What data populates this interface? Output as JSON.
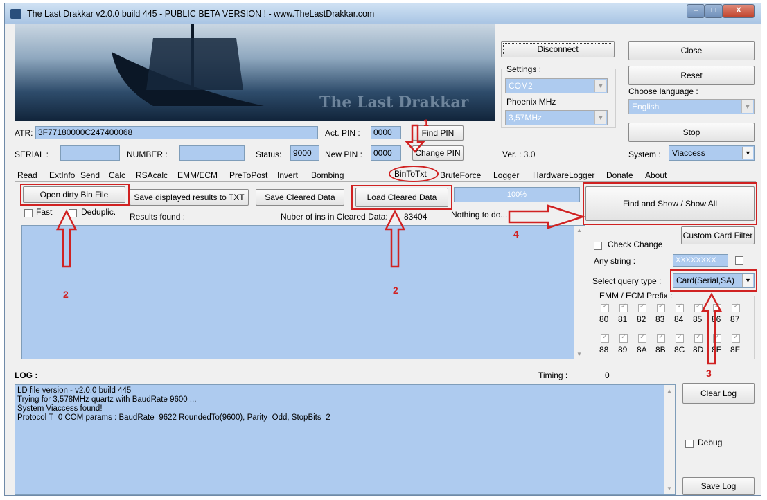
{
  "window": {
    "title": "The Last Drakkar v2.0.0 build 445  -  PUBLIC BETA VERSION ! - www.TheLastDrakkar.com",
    "banner_text": "The Last Drakkar",
    "minimize": "–",
    "maximize": "□",
    "close": "X"
  },
  "right_panel": {
    "disconnect": "Disconnect",
    "close": "Close",
    "reset": "Reset",
    "settings_label": "Settings :",
    "com_port": "COM2",
    "phoenix_label": "Phoenix MHz",
    "mhz_value": "3,57MHz",
    "choose_language_label": "Choose language :",
    "language": "English",
    "stop": "Stop",
    "version": "Ver. : 3.0",
    "system_label": "System :",
    "system_value": "Viaccess"
  },
  "card": {
    "atr_label": "ATR:",
    "atr_value": "3F77180000C247400068",
    "act_pin_label": "Act. PIN :",
    "act_pin_value": "0000",
    "find_pin": "Find PIN",
    "serial_label": "SERIAL :",
    "serial_value": "",
    "number_label": "NUMBER :",
    "number_value": "",
    "status_label": "Status:",
    "status_value": "9000",
    "new_pin_label": "New PIN :",
    "new_pin_value": "0000",
    "change_pin": "Change PIN"
  },
  "tabs": [
    "Read",
    "ExtInfo",
    "Send",
    "Calc",
    "RSAcalc",
    "EMM/ECM",
    "PreToPost",
    "Invert",
    "Bombing",
    "BinToTxt",
    "BruteForce",
    "Logger",
    "HardwareLogger",
    "Donate",
    "About"
  ],
  "bintotxt": {
    "open_dirty": "Open dirty Bin File",
    "save_displayed": "Save displayed results to TXT",
    "save_cleared": "Save Cleared Data",
    "load_cleared": "Load Cleared Data",
    "progress_text": "100%",
    "progress": 1.0,
    "find_show": "Find and Show / Show All",
    "fast_label": "Fast",
    "deduplic_label": "Deduplic.",
    "results_found": "Results found :",
    "ins_count_label": "Nuber of ins in Cleared Data:",
    "ins_count": "83404",
    "nothing": "Nothing to do...",
    "custom_filter": "Custom Card Filter",
    "check_change": "Check Change",
    "any_string_label": "Any string :",
    "any_string_value": "XXXXXXXX",
    "select_query_label": "Select query type :",
    "query_value": "Card(Serial,SA)",
    "prefix_label": "EMM / ECM Prefix :",
    "prefixes_row1": [
      "80",
      "81",
      "82",
      "83",
      "84",
      "85",
      "86",
      "87"
    ],
    "prefixes_row2": [
      "88",
      "89",
      "8A",
      "8B",
      "8C",
      "8D",
      "8E",
      "8F"
    ]
  },
  "annotations": [
    "1",
    "2",
    "2",
    "3",
    "4"
  ],
  "log": {
    "title": "LOG :",
    "timing_label": "Timing :",
    "timing_value": "0",
    "lines": [
      "LD file version - v2.0.0 build 445",
      "Trying for 3,578MHz quartz with BaudRate 9600 ...",
      "System Viaccess found!",
      "Protocol T=0 COM params : BaudRate=9622 RoundedTo(9600), Parity=Odd, StopBits=2"
    ],
    "clear_log": "Clear Log",
    "debug_label": "Debug",
    "save_log": "Save Log"
  },
  "colors": {
    "field_blue": "#aecbef",
    "annotation_red": "#d02222"
  }
}
